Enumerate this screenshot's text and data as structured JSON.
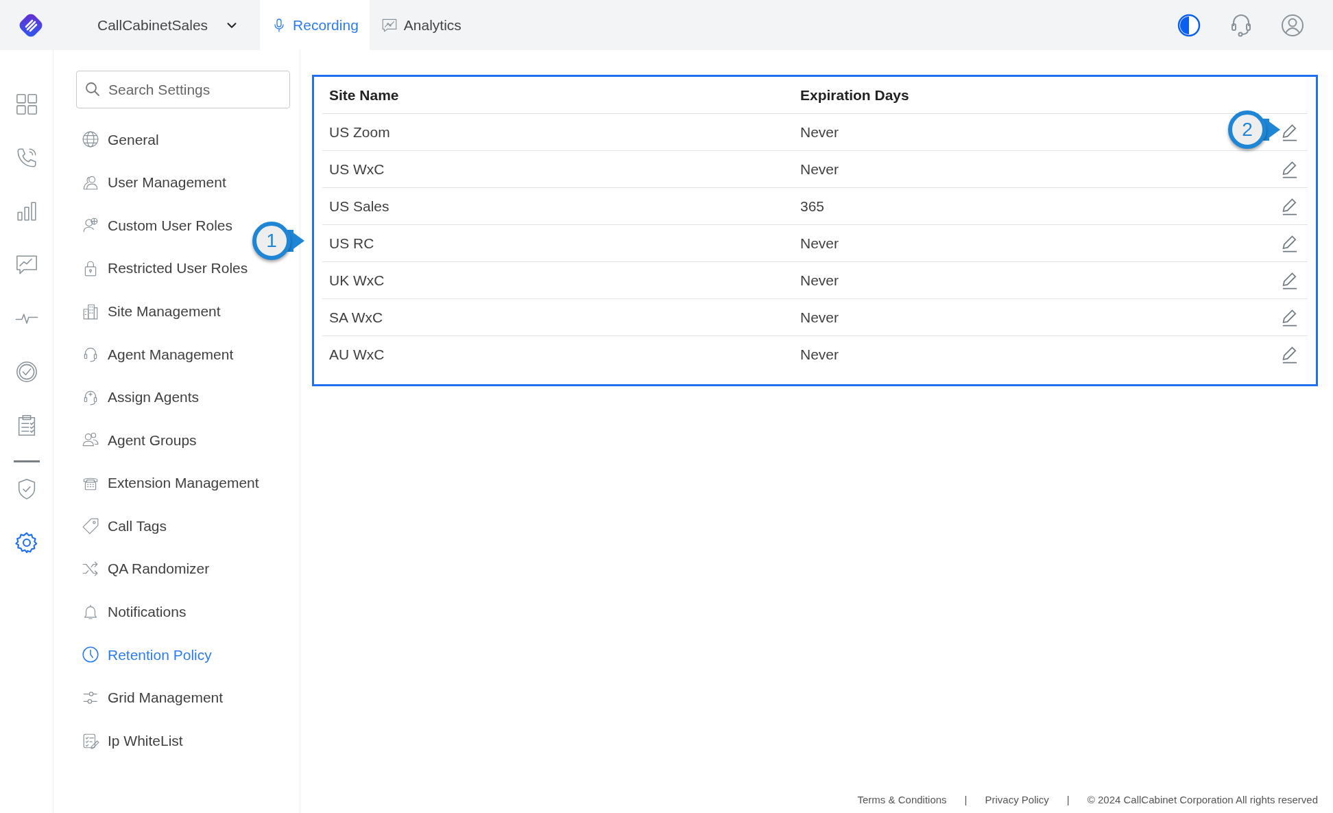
{
  "top_bar": {
    "workspace": "CallCabinetSales",
    "tabs": [
      {
        "label": "Recording",
        "selected": true
      },
      {
        "label": "Analytics",
        "selected": false
      }
    ]
  },
  "rail": [
    {
      "selected": false
    },
    {
      "selected": false
    },
    {
      "selected": false
    },
    {
      "selected": false
    },
    {
      "selected": false
    },
    {
      "selected": false
    },
    {
      "selected": false
    },
    {
      "selected": false
    },
    {
      "selected": true
    }
  ],
  "settings_menu": {
    "search": {
      "placeholder": "Search Settings"
    },
    "items": [
      {
        "label": "General",
        "selected": false
      },
      {
        "label": "User Management",
        "selected": false
      },
      {
        "label": "Custom User Roles",
        "selected": false
      },
      {
        "label": "Restricted User Roles",
        "selected": false
      },
      {
        "label": "Site Management",
        "selected": false
      },
      {
        "label": "Agent Management",
        "selected": false
      },
      {
        "label": "Assign Agents",
        "selected": false
      },
      {
        "label": "Agent Groups",
        "selected": false
      },
      {
        "label": "Extension Management",
        "selected": false
      },
      {
        "label": "Call Tags",
        "selected": false
      },
      {
        "label": "QA Randomizer",
        "selected": false
      },
      {
        "label": "Notifications",
        "selected": false
      },
      {
        "label": "Retention Policy",
        "selected": true
      },
      {
        "label": "Grid Management",
        "selected": false
      },
      {
        "label": "Ip WhiteList",
        "selected": false
      }
    ]
  },
  "table": {
    "columns": [
      "Site Name",
      "Expiration Days"
    ],
    "rows": [
      {
        "site_name": "US Zoom",
        "expiration_days": "Never"
      },
      {
        "site_name": "US WxC",
        "expiration_days": "Never"
      },
      {
        "site_name": "US Sales",
        "expiration_days": "365"
      },
      {
        "site_name": "US RC",
        "expiration_days": "Never"
      },
      {
        "site_name": "UK WxC",
        "expiration_days": "Never"
      },
      {
        "site_name": "SA WxC",
        "expiration_days": "Never"
      },
      {
        "site_name": "AU WxC",
        "expiration_days": "Never"
      }
    ]
  },
  "callouts": [
    {
      "number": "1"
    },
    {
      "number": "2"
    }
  ],
  "footer": {
    "links": [
      {
        "text": "Terms & Conditions",
        "separator": "|"
      },
      {
        "text": "Privacy Policy",
        "separator": "|"
      }
    ],
    "copyright": "© 2024 CallCabinet Corporation All rights reserved"
  }
}
